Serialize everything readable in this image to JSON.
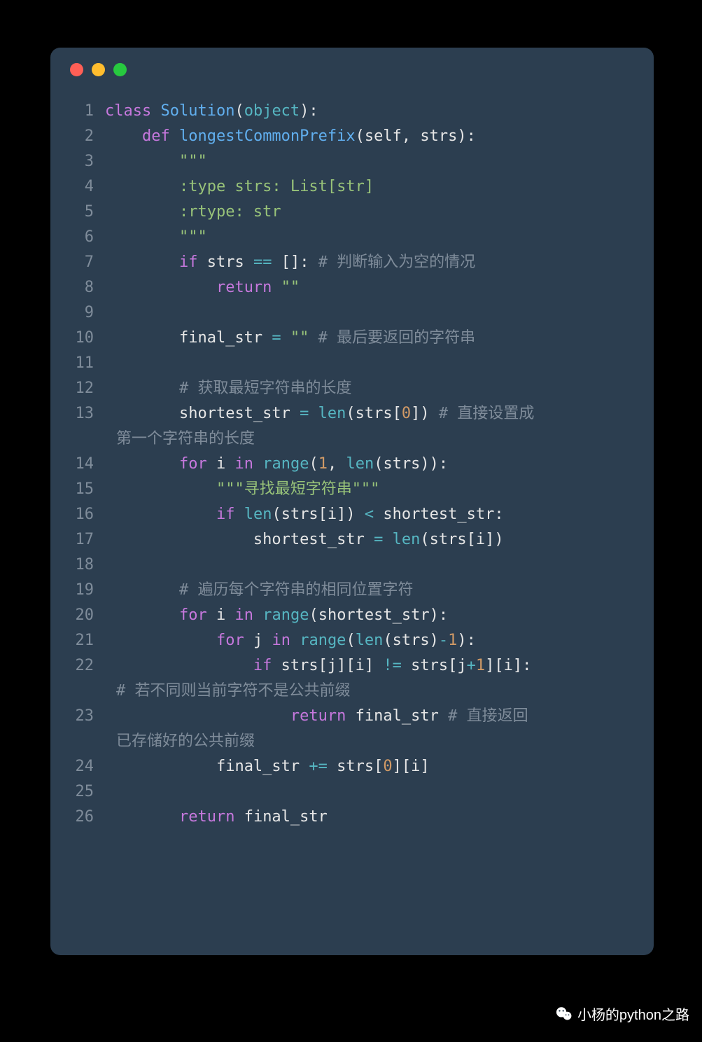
{
  "window": {
    "traffic_lights": [
      "close",
      "minimize",
      "zoom"
    ]
  },
  "code": {
    "lines": [
      {
        "n": 1,
        "tokens": [
          [
            "kw",
            "class"
          ],
          [
            "punc",
            " "
          ],
          [
            "cls",
            "Solution"
          ],
          [
            "punc",
            "("
          ],
          [
            "bi",
            "object"
          ],
          [
            "punc",
            "):"
          ]
        ]
      },
      {
        "n": 2,
        "indent": 1,
        "tokens": [
          [
            "kw",
            "def"
          ],
          [
            "punc",
            " "
          ],
          [
            "fn",
            "longestCommonPrefix"
          ],
          [
            "punc",
            "("
          ],
          [
            "par",
            "self"
          ],
          [
            "punc",
            ", "
          ],
          [
            "par",
            "strs"
          ],
          [
            "punc",
            "):"
          ]
        ]
      },
      {
        "n": 3,
        "indent": 2,
        "tokens": [
          [
            "str",
            "\"\"\""
          ]
        ]
      },
      {
        "n": 4,
        "indent": 2,
        "tokens": [
          [
            "str",
            ":type strs: List[str]"
          ]
        ]
      },
      {
        "n": 5,
        "indent": 2,
        "tokens": [
          [
            "str",
            ":rtype: str"
          ]
        ]
      },
      {
        "n": 6,
        "indent": 2,
        "tokens": [
          [
            "str",
            "\"\"\""
          ]
        ]
      },
      {
        "n": 7,
        "indent": 2,
        "tokens": [
          [
            "kw",
            "if"
          ],
          [
            "punc",
            " strs "
          ],
          [
            "op",
            "=="
          ],
          [
            "punc",
            " []: "
          ],
          [
            "cmt",
            "# 判断输入为空的情况"
          ]
        ]
      },
      {
        "n": 8,
        "indent": 3,
        "tokens": [
          [
            "kw",
            "return"
          ],
          [
            "punc",
            " "
          ],
          [
            "str",
            "\"\""
          ]
        ]
      },
      {
        "n": 9,
        "indent": 0,
        "tokens": []
      },
      {
        "n": 10,
        "indent": 2,
        "tokens": [
          [
            "punc",
            "final_str "
          ],
          [
            "op",
            "="
          ],
          [
            "punc",
            " "
          ],
          [
            "str",
            "\"\""
          ],
          [
            "punc",
            " "
          ],
          [
            "cmt",
            "# 最后要返回的字符串"
          ]
        ]
      },
      {
        "n": 11,
        "indent": 0,
        "tokens": []
      },
      {
        "n": 12,
        "indent": 2,
        "tokens": [
          [
            "cmt",
            "# 获取最短字符串的长度"
          ]
        ]
      },
      {
        "n": 13,
        "indent": 2,
        "tokens": [
          [
            "punc",
            "shortest_str "
          ],
          [
            "op",
            "="
          ],
          [
            "punc",
            " "
          ],
          [
            "bi",
            "len"
          ],
          [
            "punc",
            "(strs["
          ],
          [
            "num",
            "0"
          ],
          [
            "punc",
            "]) "
          ],
          [
            "cmt",
            "# 直接设置成"
          ]
        ],
        "wrap": "第一个字符串的长度"
      },
      {
        "n": 14,
        "indent": 2,
        "tokens": [
          [
            "kw",
            "for"
          ],
          [
            "punc",
            " i "
          ],
          [
            "kw",
            "in"
          ],
          [
            "punc",
            " "
          ],
          [
            "bi",
            "range"
          ],
          [
            "punc",
            "("
          ],
          [
            "num",
            "1"
          ],
          [
            "punc",
            ", "
          ],
          [
            "bi",
            "len"
          ],
          [
            "punc",
            "(strs)):"
          ]
        ]
      },
      {
        "n": 15,
        "indent": 3,
        "tokens": [
          [
            "str",
            "\"\"\"寻找最短字符串\"\"\""
          ]
        ]
      },
      {
        "n": 16,
        "indent": 3,
        "tokens": [
          [
            "kw",
            "if"
          ],
          [
            "punc",
            " "
          ],
          [
            "bi",
            "len"
          ],
          [
            "punc",
            "(strs[i]) "
          ],
          [
            "op",
            "<"
          ],
          [
            "punc",
            " shortest_str:"
          ]
        ]
      },
      {
        "n": 17,
        "indent": 4,
        "tokens": [
          [
            "punc",
            "shortest_str "
          ],
          [
            "op",
            "="
          ],
          [
            "punc",
            " "
          ],
          [
            "bi",
            "len"
          ],
          [
            "punc",
            "(strs[i])"
          ]
        ]
      },
      {
        "n": 18,
        "indent": 0,
        "tokens": []
      },
      {
        "n": 19,
        "indent": 2,
        "tokens": [
          [
            "cmt",
            "# 遍历每个字符串的相同位置字符"
          ]
        ]
      },
      {
        "n": 20,
        "indent": 2,
        "tokens": [
          [
            "kw",
            "for"
          ],
          [
            "punc",
            " i "
          ],
          [
            "kw",
            "in"
          ],
          [
            "punc",
            " "
          ],
          [
            "bi",
            "range"
          ],
          [
            "punc",
            "(shortest_str):"
          ]
        ]
      },
      {
        "n": 21,
        "indent": 3,
        "tokens": [
          [
            "kw",
            "for"
          ],
          [
            "punc",
            " j "
          ],
          [
            "kw",
            "in"
          ],
          [
            "punc",
            " "
          ],
          [
            "bi",
            "range"
          ],
          [
            "punc",
            "("
          ],
          [
            "bi",
            "len"
          ],
          [
            "punc",
            "(strs)"
          ],
          [
            "op",
            "-"
          ],
          [
            "num",
            "1"
          ],
          [
            "punc",
            "):"
          ]
        ]
      },
      {
        "n": 22,
        "indent": 4,
        "tokens": [
          [
            "kw",
            "if"
          ],
          [
            "punc",
            " strs[j][i] "
          ],
          [
            "op",
            "!="
          ],
          [
            "punc",
            " strs[j"
          ],
          [
            "op",
            "+"
          ],
          [
            "num",
            "1"
          ],
          [
            "punc",
            "][i]:"
          ]
        ],
        "wrap": "# 若不同则当前字符不是公共前缀"
      },
      {
        "n": 23,
        "indent": 5,
        "tokens": [
          [
            "kw",
            "return"
          ],
          [
            "punc",
            " final_str "
          ],
          [
            "cmt",
            "# 直接返回"
          ]
        ],
        "wrap": "已存储好的公共前缀"
      },
      {
        "n": 24,
        "indent": 3,
        "tokens": [
          [
            "punc",
            "final_str "
          ],
          [
            "op",
            "+="
          ],
          [
            "punc",
            " strs["
          ],
          [
            "num",
            "0"
          ],
          [
            "punc",
            "][i]"
          ]
        ]
      },
      {
        "n": 25,
        "indent": 0,
        "tokens": []
      },
      {
        "n": 26,
        "indent": 2,
        "tokens": [
          [
            "kw",
            "return"
          ],
          [
            "punc",
            " final_str"
          ]
        ]
      }
    ],
    "indent_unit": "    "
  },
  "watermark": {
    "text": "小杨的python之路",
    "icon": "wechat-icon"
  }
}
